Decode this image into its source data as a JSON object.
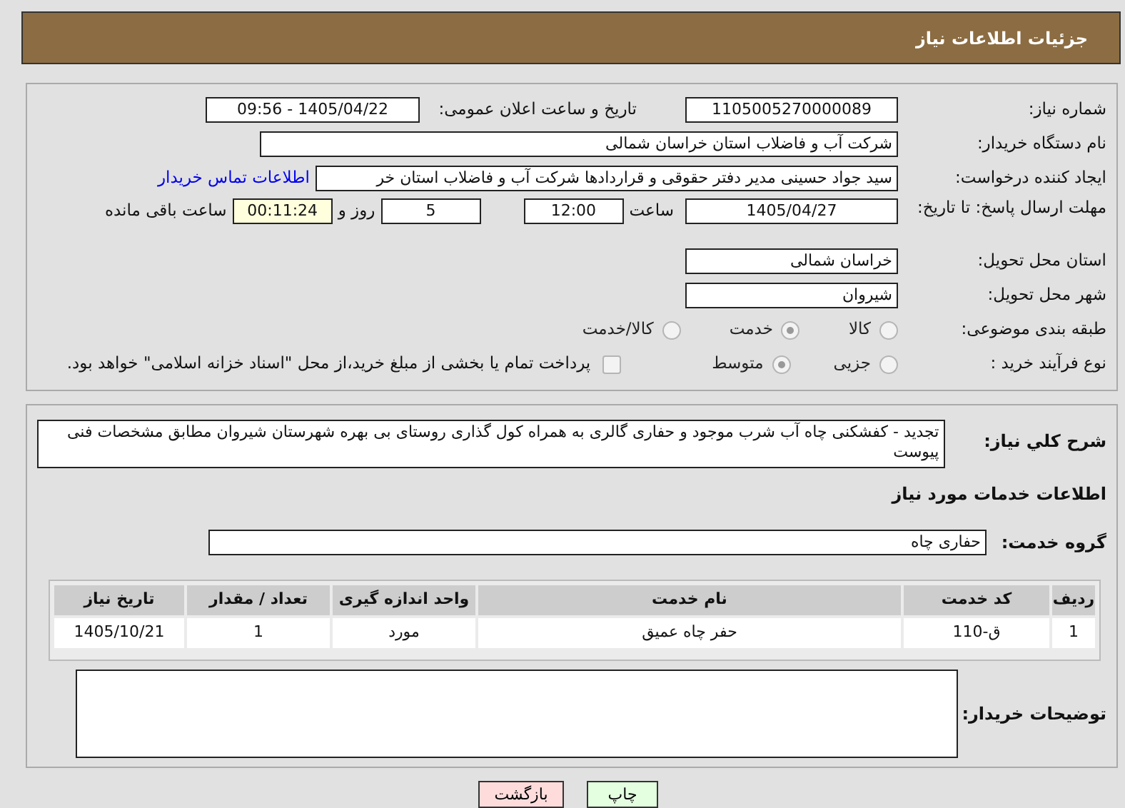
{
  "header": {
    "title": "جزئیات اطلاعات نیاز"
  },
  "need_number": {
    "label": "شماره نیاز:",
    "value": "1105005270000089"
  },
  "announce": {
    "label": "تاریخ و ساعت اعلان عمومی:",
    "value": "1405/04/22 - 09:56"
  },
  "buyer": {
    "label": "نام دستگاه خریدار:",
    "value": "شرکت آب و فاضلاب استان خراسان شمالی"
  },
  "creator": {
    "label": "ایجاد کننده درخواست:",
    "value": "سید جواد حسینی مدیر دفتر حقوقی و قراردادها  شرکت آب و فاضلاب استان خر",
    "link": "اطلاعات تماس خریدار"
  },
  "deadline": {
    "label": "مهلت ارسال پاسخ: تا تاریخ:",
    "date": "1405/04/27",
    "time_label": "ساعت",
    "time": "12:00",
    "days": "5",
    "days_label": "روز و",
    "remaining": "00:11:24",
    "remaining_label": "ساعت باقی مانده"
  },
  "province": {
    "label": "استان محل تحویل:",
    "value": "خراسان شمالی"
  },
  "city": {
    "label": "شهر محل تحویل:",
    "value": "شیروان"
  },
  "category": {
    "label": "طبقه بندی موضوعی:",
    "options": [
      {
        "label": "کالا",
        "selected": false,
        "disabled": true
      },
      {
        "label": "خدمت",
        "selected": true,
        "disabled": true
      },
      {
        "label": "کالا/خدمت",
        "selected": false,
        "disabled": true
      }
    ]
  },
  "process": {
    "label": "نوع فرآیند خرید :",
    "options": [
      {
        "label": "جزیی",
        "selected": false,
        "disabled": true
      },
      {
        "label": "متوسط",
        "selected": true,
        "disabled": true
      }
    ],
    "checkbox": {
      "label": "پرداخت تمام یا بخشی از مبلغ خرید،از محل \"اسناد خزانه اسلامی\" خواهد بود.",
      "checked": false,
      "disabled": true
    }
  },
  "description": {
    "label": "شرح كلي نياز:",
    "value": "تجدید - کفشکنی چاه آب شرب موجود و حفاری گالری به همراه کول گذاری روستای بی بهره شهرستان شیروان مطابق مشخصات فنی پیوست"
  },
  "services_heading": "اطلاعات خدمات مورد نیاز",
  "service_group": {
    "label": "گروه خدمت:",
    "value": "حفاری چاه"
  },
  "table": {
    "columns": [
      "ردیف",
      "کد خدمت",
      "نام خدمت",
      "واحد اندازه گیری",
      "تعداد / مقدار",
      "تاریخ نیاز"
    ],
    "rows": [
      [
        "1",
        "ق-110",
        "حفر چاه عمیق",
        "مورد",
        "1",
        "1405/10/21"
      ]
    ]
  },
  "buyer_notes": {
    "label": "توضیحات خریدار:"
  },
  "buttons": [
    {
      "label": "چاپ",
      "kind": "print"
    },
    {
      "label": "بازگشت",
      "kind": "back"
    }
  ]
}
